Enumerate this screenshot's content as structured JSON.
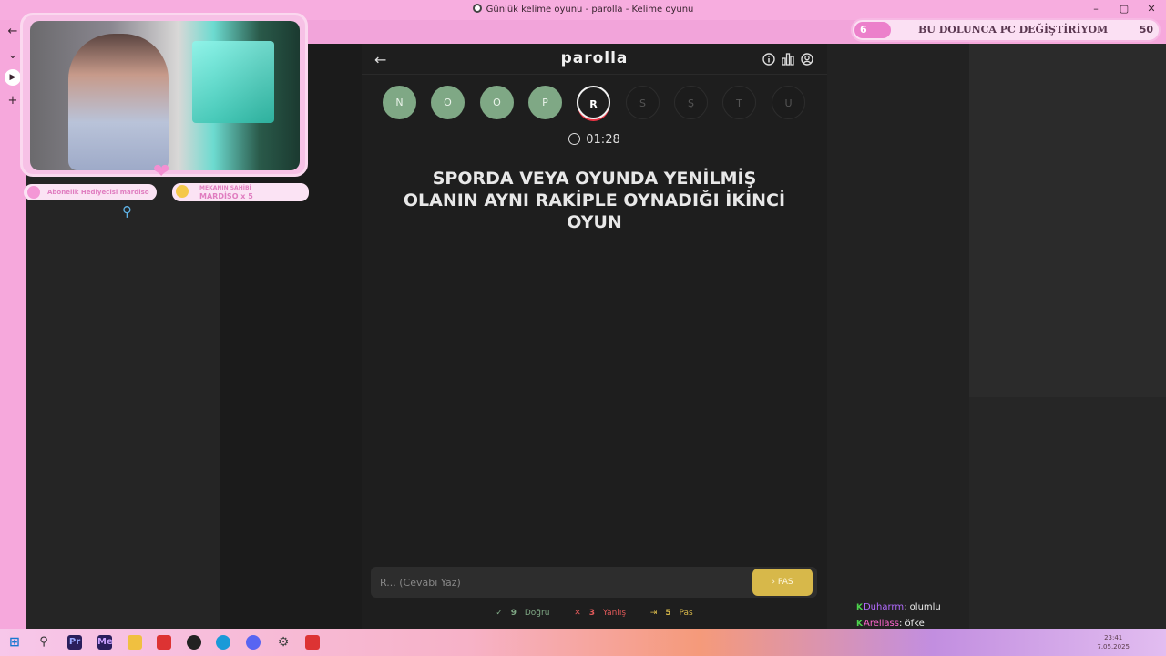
{
  "window": {
    "title": "Günlük kelime oyunu - parolla - Kelime oyunu",
    "controls": [
      "–",
      "▢",
      "✕"
    ]
  },
  "rail": [
    "←",
    "⌄",
    "▶",
    "+"
  ],
  "game": {
    "logo": "parolla",
    "letters": [
      {
        "char": "N",
        "state": "done"
      },
      {
        "char": "O",
        "state": "done"
      },
      {
        "char": "Ö",
        "state": "done"
      },
      {
        "char": "P",
        "state": "done"
      },
      {
        "char": "R",
        "state": "current"
      },
      {
        "char": "S",
        "state": "todo"
      },
      {
        "char": "Ş",
        "state": "todo"
      },
      {
        "char": "T",
        "state": "todo"
      },
      {
        "char": "U",
        "state": "todo"
      }
    ],
    "timer": "01:28",
    "question": "SPORDA VEYA OYUNDA YENİLMİŞ OLANIN AYNI RAKİPLE OYNADIĞI İKİNCİ OYUN",
    "answer_placeholder": "R... (Cevabı Yaz)",
    "pass_label": "PAS",
    "stats": {
      "correct_count": "9",
      "correct_label": "Doğru",
      "wrong_count": "3",
      "wrong_label": "Yanlış",
      "pass_count": "5",
      "pass_label": "Pas"
    }
  },
  "overlay": {
    "badge1": "Abonelik Hediyecisi mardiso",
    "badge2_title": "MEKANIN SAHİBİ",
    "badge2_name": "MARDİSO x 5",
    "goal_count": "6",
    "goal_text": "BU DOLUNCA PC DEĞİŞTİRİYOM",
    "goal_target": "50"
  },
  "chat": [
    {
      "user": "Duharrm",
      "message": "olumlu"
    },
    {
      "user": "Arellass",
      "message": "öfke"
    }
  ],
  "taskbar": {
    "time": "23:41",
    "date": "7.05.2025"
  },
  "colors": {
    "done_letter": "#7fa885",
    "pass_button": "#d7b84a",
    "wrong": "#e35a5a",
    "correct": "#7fa885",
    "pass_stat": "#d7b84a",
    "stream_pink": "#f6a8dc"
  }
}
